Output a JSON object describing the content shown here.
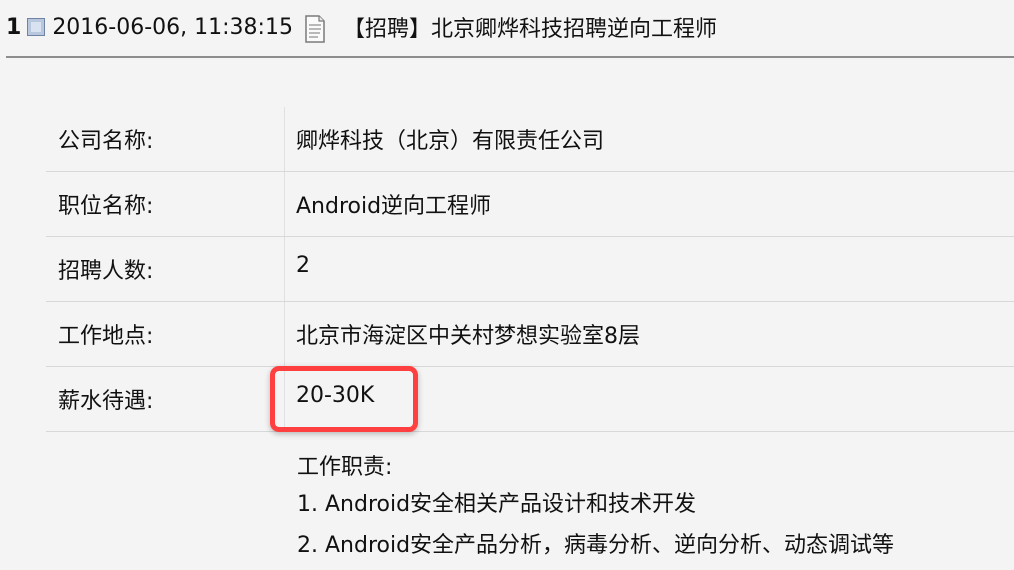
{
  "post": {
    "number": "1",
    "timestamp": "2016-06-06, 11:38:15",
    "title": "【招聘】北京卿烨科技招聘逆向工程师"
  },
  "job": {
    "rows": [
      {
        "label": "公司名称:",
        "value": "卿烨科技（北京）有限责任公司"
      },
      {
        "label": "职位名称:",
        "value": "Android逆向工程师"
      },
      {
        "label": "招聘人数:",
        "value": "2"
      },
      {
        "label": "工作地点:",
        "value": "北京市海淀区中关村梦想实验室8层"
      },
      {
        "label": "薪水待遇:",
        "value": "20-30K"
      }
    ],
    "duties": {
      "title": "工作职责:",
      "items": [
        "1. Android安全相关产品设计和技术开发",
        "2. Android安全产品分析，病毒分析、逆向分析、动态调试等"
      ]
    }
  },
  "colors": {
    "highlight": "#ff4040",
    "background": "#f4f4f4",
    "divider": "#8d8d8d"
  },
  "icons": {
    "post_status": "post-status-icon",
    "document": "document-icon"
  }
}
